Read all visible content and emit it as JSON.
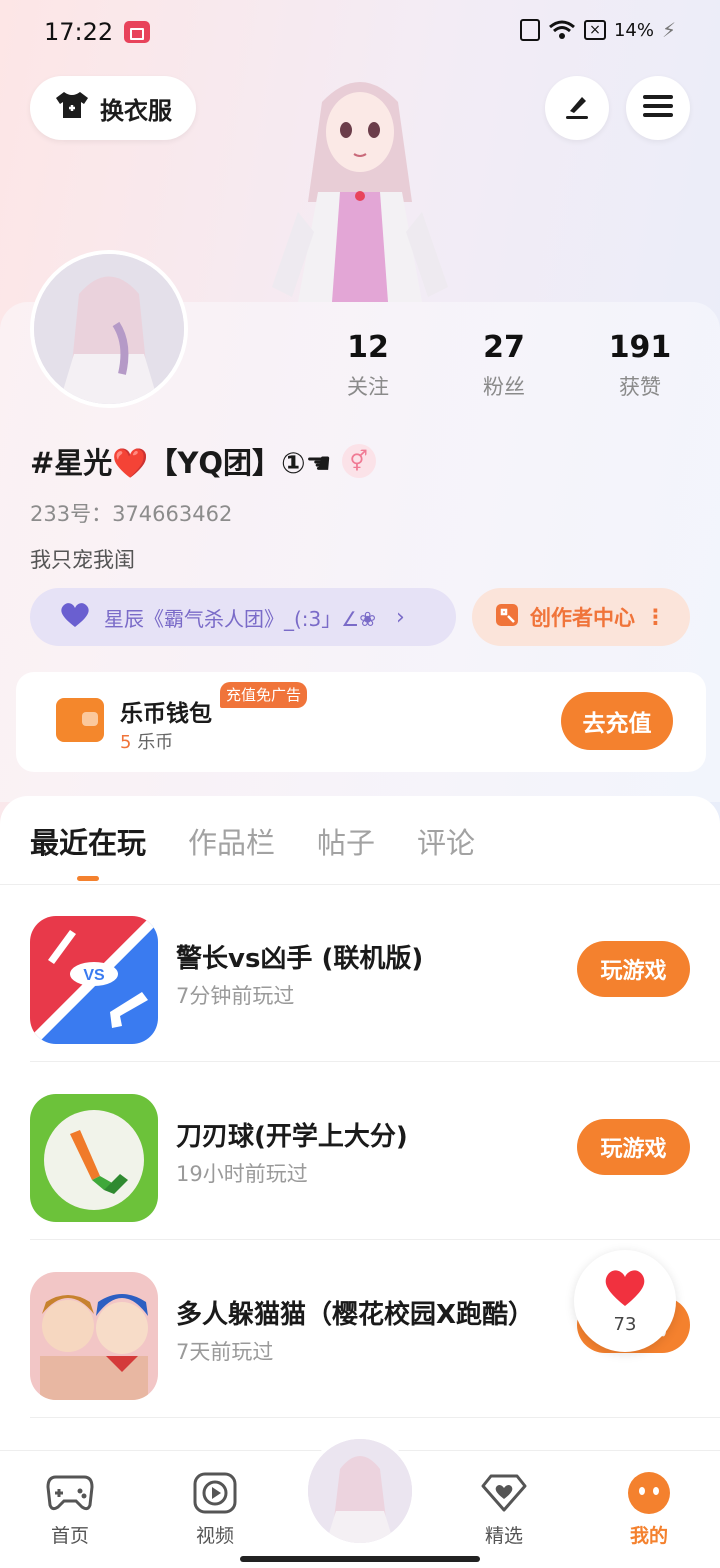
{
  "status_bar": {
    "time": "17:22",
    "battery": "14%"
  },
  "header": {
    "dress_label": "换衣服"
  },
  "profile": {
    "stats": [
      {
        "value": "12",
        "label": "关注"
      },
      {
        "value": "27",
        "label": "粉丝"
      },
      {
        "value": "191",
        "label": "获赞"
      }
    ],
    "name": "#星光❤️【YQ团】①☚",
    "gender_symbol": "⚥",
    "uid": "233号：374663462",
    "bio": "我只宠我闺",
    "team_chip": "星辰《霸气杀人团》_(:3」∠❀",
    "team_arrow": "›",
    "creator_chip": "创作者中心",
    "creator_more": "⋮"
  },
  "wallet": {
    "title": "乐币钱包",
    "badge": "充值免广告",
    "amount": "5",
    "unit": "乐币",
    "button": "去充值"
  },
  "tabs": [
    {
      "label": "最近在玩",
      "active": true
    },
    {
      "label": "作品栏",
      "active": false
    },
    {
      "label": "帖子",
      "active": false
    },
    {
      "label": "评论",
      "active": false
    }
  ],
  "games": [
    {
      "title": "警长vs凶手 (联机版)",
      "played": "7分钟前玩过",
      "button": "玩游戏",
      "icon": "sheriff-vs-killer-icon"
    },
    {
      "title": "刀刃球(开学上大分)",
      "played": "19小时前玩过",
      "button": "玩游戏",
      "icon": "blade-ball-icon"
    },
    {
      "title": "多人躲猫猫（樱花校园X跑酷）",
      "played": "7天前玩过",
      "button": "玩游戏",
      "icon": "hide-and-seek-icon"
    }
  ],
  "like_float": {
    "count": "73"
  },
  "bottom_nav": [
    {
      "label": "首页",
      "icon": "gamepad-icon",
      "active": false
    },
    {
      "label": "视频",
      "icon": "play-icon",
      "active": false
    },
    {
      "label": "精选",
      "icon": "heart-diamond-icon",
      "active": false
    },
    {
      "label": "我的",
      "icon": "face-icon",
      "active": true
    }
  ],
  "colors": {
    "accent": "#f4812e",
    "team_chip_text": "#7a6bc8",
    "creator_text": "#f0743a"
  }
}
